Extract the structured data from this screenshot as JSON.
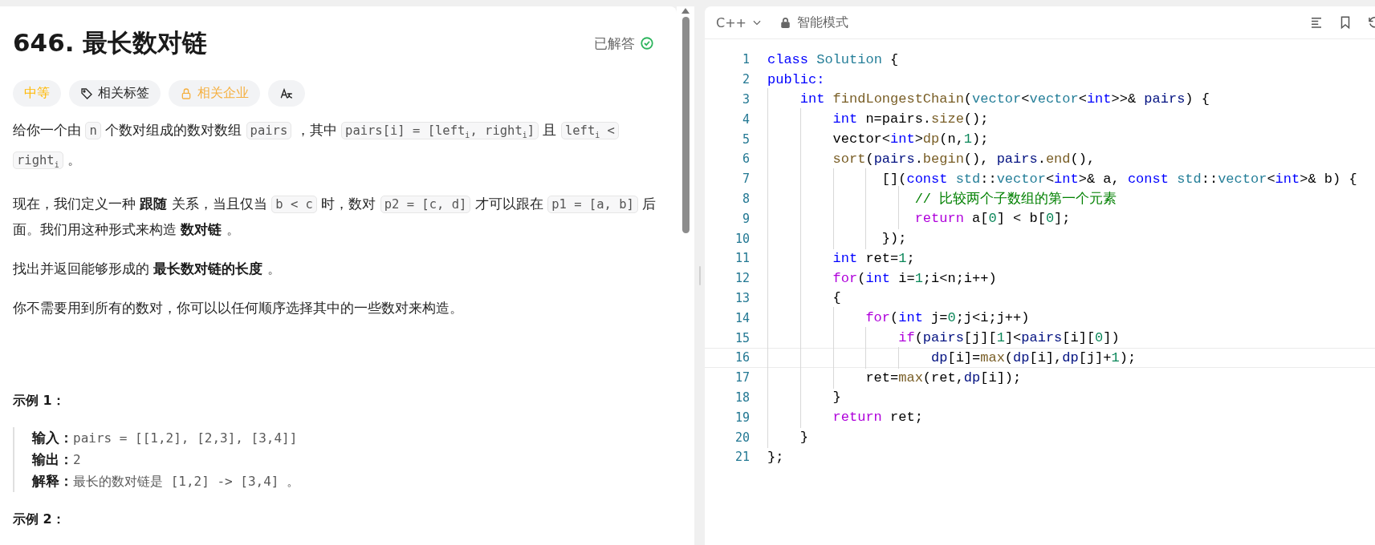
{
  "problem": {
    "title": "646. 最长数对链",
    "status": "已解答",
    "solved": true,
    "tags": [
      {
        "kind": "difficulty",
        "label": "中等"
      },
      {
        "kind": "topics",
        "label": "相关标签"
      },
      {
        "kind": "companies",
        "label": "相关企业"
      },
      {
        "kind": "translate"
      }
    ],
    "paragraphs": [
      [
        {
          "kind": "text",
          "text": "给你一个由 "
        },
        {
          "kind": "code",
          "text": "n"
        },
        {
          "kind": "text",
          "text": " 个数对组成的数对数组 "
        },
        {
          "kind": "code",
          "text": "pairs"
        },
        {
          "kind": "text",
          "text": " ，其中 "
        },
        {
          "kind": "code",
          "text": "pairs[i] = [left$_{i}$, right$_{i}$]"
        },
        {
          "kind": "text",
          "text": " 且 "
        },
        {
          "kind": "code",
          "text": "left$_{i}$ < right$_{i}$"
        },
        {
          "kind": "text",
          "text": " 。"
        }
      ],
      [
        {
          "kind": "text",
          "text": "现在，我们定义一种 **跟随** 关系，当且仅当 "
        },
        {
          "kind": "code",
          "text": "b < c"
        },
        {
          "kind": "text",
          "text": " 时，数对 "
        },
        {
          "kind": "code",
          "text": "p2 = [c, d]"
        },
        {
          "kind": "text",
          "text": " 才可以跟在 "
        },
        {
          "kind": "code",
          "text": "p1 = [a, b]"
        },
        {
          "kind": "text",
          "text": " 后面。我们用这种形式来构造 **数对链** 。"
        }
      ],
      [
        {
          "kind": "text",
          "text": "找出并返回能够形成的 **最长数对链的长度** 。"
        }
      ],
      [
        {
          "kind": "text",
          "text": "你不需要用到所有的数对，你可以以任何顺序选择其中的一些数对来构造。"
        }
      ]
    ],
    "examples": [
      {
        "title": "示例 1：",
        "lines": [
          {
            "label": "输入：",
            "value": "pairs = [[1,2], [2,3], [3,4]]"
          },
          {
            "label": "输出：",
            "value": "2"
          },
          {
            "label": "解释：",
            "value": "最长的数对链是 [1,2] -> [3,4] 。"
          }
        ]
      },
      {
        "title": "示例 2："
      }
    ]
  },
  "editor": {
    "language": "C++",
    "mode": "智能模式",
    "lines": [
      {
        "number": "1",
        "current": false,
        "tokens": [
          {
            "kind": "kw",
            "text": "class"
          },
          {
            "kind": "type",
            "text": " Solution"
          },
          {
            "kind": "plain",
            "text": " {"
          }
        ]
      },
      {
        "number": "2",
        "current": false,
        "tokens": [
          {
            "kind": "kw",
            "text": "public:"
          }
        ]
      },
      {
        "number": "3",
        "current": false,
        "tokens": [
          {
            "kind": "kw",
            "text": "    int"
          },
          {
            "kind": "fn",
            "text": " findLongestChain"
          },
          {
            "kind": "plain",
            "text": "("
          },
          {
            "kind": "type",
            "text": "vector"
          },
          {
            "kind": "plain",
            "text": "<"
          },
          {
            "kind": "type",
            "text": "vector"
          },
          {
            "kind": "plain",
            "text": "<"
          },
          {
            "kind": "kw",
            "text": "int"
          },
          {
            "kind": "plain",
            "text": ">>& "
          },
          {
            "kind": "var",
            "text": "pairs"
          },
          {
            "kind": "plain",
            "text": ") {"
          }
        ]
      },
      {
        "number": "4",
        "current": false,
        "tokens": [
          {
            "kind": "kw",
            "text": "        int"
          },
          {
            "kind": "plain",
            "text": " n=pairs."
          },
          {
            "kind": "fn",
            "text": "size"
          },
          {
            "kind": "plain",
            "text": "();"
          }
        ]
      },
      {
        "number": "5",
        "current": false,
        "tokens": [
          {
            "kind": "plain",
            "text": "        vector<"
          },
          {
            "kind": "kw",
            "text": "int"
          },
          {
            "kind": "plain",
            "text": ">"
          },
          {
            "kind": "fn",
            "text": "dp"
          },
          {
            "kind": "plain",
            "text": "(n,"
          },
          {
            "kind": "num",
            "text": "1"
          },
          {
            "kind": "plain",
            "text": ");"
          }
        ]
      },
      {
        "number": "6",
        "current": false,
        "tokens": [
          {
            "kind": "fn",
            "text": "        sort"
          },
          {
            "kind": "plain",
            "text": "("
          },
          {
            "kind": "var",
            "text": "pairs"
          },
          {
            "kind": "plain",
            "text": "."
          },
          {
            "kind": "fn",
            "text": "begin"
          },
          {
            "kind": "plain",
            "text": "(), "
          },
          {
            "kind": "var",
            "text": "pairs"
          },
          {
            "kind": "plain",
            "text": "."
          },
          {
            "kind": "fn",
            "text": "end"
          },
          {
            "kind": "plain",
            "text": "(),"
          }
        ]
      },
      {
        "number": "7",
        "current": false,
        "tokens": [
          {
            "kind": "plain",
            "text": "              []("
          },
          {
            "kind": "kw",
            "text": "const"
          },
          {
            "kind": "type",
            "text": " std"
          },
          {
            "kind": "plain",
            "text": "::"
          },
          {
            "kind": "type",
            "text": "vector"
          },
          {
            "kind": "plain",
            "text": "<"
          },
          {
            "kind": "kw",
            "text": "int"
          },
          {
            "kind": "plain",
            "text": ">& a, "
          },
          {
            "kind": "kw",
            "text": "const"
          },
          {
            "kind": "type",
            "text": " std"
          },
          {
            "kind": "plain",
            "text": "::"
          },
          {
            "kind": "type",
            "text": "vector"
          },
          {
            "kind": "plain",
            "text": "<"
          },
          {
            "kind": "kw",
            "text": "int"
          },
          {
            "kind": "plain",
            "text": ">& b) {"
          }
        ]
      },
      {
        "number": "8",
        "current": false,
        "tokens": [
          {
            "kind": "cmt",
            "text": "                  // 比较两个子数组的第一个元素"
          }
        ]
      },
      {
        "number": "9",
        "current": false,
        "tokens": [
          {
            "kind": "ctrl",
            "text": "                  return"
          },
          {
            "kind": "plain",
            "text": " a["
          },
          {
            "kind": "num",
            "text": "0"
          },
          {
            "kind": "plain",
            "text": "] < b["
          },
          {
            "kind": "num",
            "text": "0"
          },
          {
            "kind": "plain",
            "text": "];"
          }
        ]
      },
      {
        "number": "10",
        "current": false,
        "tokens": [
          {
            "kind": "plain",
            "text": "              });"
          }
        ]
      },
      {
        "number": "11",
        "current": false,
        "tokens": [
          {
            "kind": "kw",
            "text": "        int"
          },
          {
            "kind": "plain",
            "text": " ret="
          },
          {
            "kind": "num",
            "text": "1"
          },
          {
            "kind": "plain",
            "text": ";"
          }
        ]
      },
      {
        "number": "12",
        "current": false,
        "tokens": [
          {
            "kind": "ctrl",
            "text": "        for"
          },
          {
            "kind": "plain",
            "text": "("
          },
          {
            "kind": "kw",
            "text": "int"
          },
          {
            "kind": "plain",
            "text": " i="
          },
          {
            "kind": "num",
            "text": "1"
          },
          {
            "kind": "plain",
            "text": ";i<n;i++)"
          }
        ]
      },
      {
        "number": "13",
        "current": false,
        "tokens": [
          {
            "kind": "plain",
            "text": "        {"
          }
        ]
      },
      {
        "number": "14",
        "current": false,
        "tokens": [
          {
            "kind": "ctrl",
            "text": "            for"
          },
          {
            "kind": "plain",
            "text": "("
          },
          {
            "kind": "kw",
            "text": "int"
          },
          {
            "kind": "plain",
            "text": " j="
          },
          {
            "kind": "num",
            "text": "0"
          },
          {
            "kind": "plain",
            "text": ";j<i;j++)"
          }
        ]
      },
      {
        "number": "15",
        "current": false,
        "tokens": [
          {
            "kind": "ctrl",
            "text": "                if"
          },
          {
            "kind": "plain",
            "text": "("
          },
          {
            "kind": "var",
            "text": "pairs"
          },
          {
            "kind": "plain",
            "text": "[j]["
          },
          {
            "kind": "num",
            "text": "1"
          },
          {
            "kind": "plain",
            "text": "]<"
          },
          {
            "kind": "var",
            "text": "pairs"
          },
          {
            "kind": "plain",
            "text": "[i]["
          },
          {
            "kind": "num",
            "text": "0"
          },
          {
            "kind": "plain",
            "text": "])"
          }
        ]
      },
      {
        "number": "16",
        "current": true,
        "tokens": [
          {
            "kind": "var",
            "text": "                    dp"
          },
          {
            "kind": "plain",
            "text": "[i]="
          },
          {
            "kind": "fn",
            "text": "max"
          },
          {
            "kind": "plain",
            "text": "("
          },
          {
            "kind": "var",
            "text": "dp"
          },
          {
            "kind": "plain",
            "text": "[i],"
          },
          {
            "kind": "var",
            "text": "dp"
          },
          {
            "kind": "plain",
            "text": "[j]+"
          },
          {
            "kind": "num",
            "text": "1"
          },
          {
            "kind": "plain",
            "text": ");"
          }
        ]
      },
      {
        "number": "17",
        "current": false,
        "tokens": [
          {
            "kind": "plain",
            "text": "            ret="
          },
          {
            "kind": "fn",
            "text": "max"
          },
          {
            "kind": "plain",
            "text": "(ret,"
          },
          {
            "kind": "var",
            "text": "dp"
          },
          {
            "kind": "plain",
            "text": "[i]);"
          }
        ]
      },
      {
        "number": "18",
        "current": false,
        "tokens": [
          {
            "kind": "plain",
            "text": "        }"
          }
        ]
      },
      {
        "number": "19",
        "current": false,
        "tokens": [
          {
            "kind": "ctrl",
            "text": "        return"
          },
          {
            "kind": "plain",
            "text": " ret;"
          }
        ]
      },
      {
        "number": "20",
        "current": false,
        "tokens": [
          {
            "kind": "plain",
            "text": "    }"
          }
        ]
      },
      {
        "number": "21",
        "current": false,
        "tokens": [
          {
            "kind": "plain",
            "text": "};"
          }
        ]
      }
    ]
  }
}
